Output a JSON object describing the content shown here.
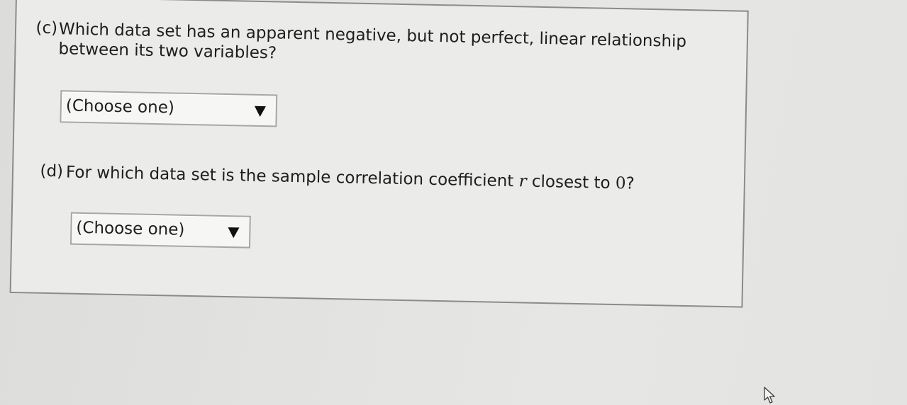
{
  "questions": [
    {
      "label": "(c)",
      "text_line1": "Which data set has an apparent negative, but not perfect, linear relationship",
      "text_line2": "between its two variables?",
      "dropdown": {
        "selected": "(Choose one)"
      }
    },
    {
      "label": "(d)",
      "text_prefix": "For which data set is the sample correlation coefficient ",
      "variable": "r",
      "text_middle": " closest to ",
      "number": "0",
      "text_suffix": "?",
      "dropdown": {
        "selected": "(Choose one)"
      }
    }
  ]
}
